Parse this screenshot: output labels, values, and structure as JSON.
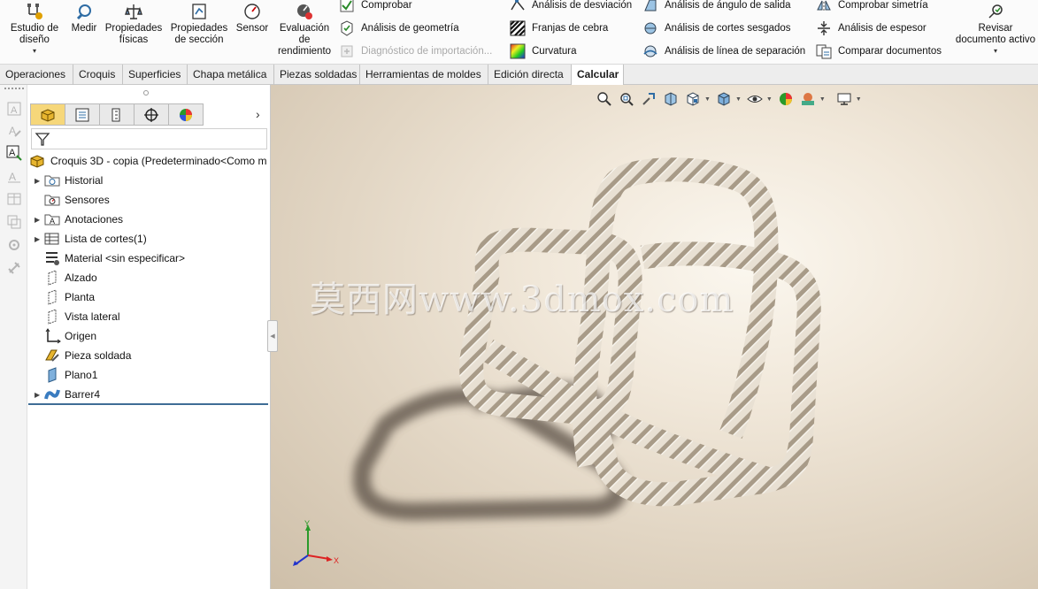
{
  "ribbon": {
    "big_buttons": [
      {
        "id": "estudio",
        "label_line1": "Estudio de",
        "label_line2": "diseño",
        "icon": "design-study-icon",
        "has_dropdown": true
      },
      {
        "id": "medir",
        "label_line1": "Medir",
        "label_line2": "",
        "icon": "measure-icon"
      },
      {
        "id": "propfisicas",
        "label_line1": "Propiedades",
        "label_line2": "físicas",
        "icon": "mass-properties-icon"
      },
      {
        "id": "propseccion",
        "label_line1": "Propiedades",
        "label_line2": "de sección",
        "icon": "section-properties-icon"
      },
      {
        "id": "sensor",
        "label_line1": "Sensor",
        "label_line2": "",
        "icon": "sensor-gauge-icon"
      },
      {
        "id": "evalrend",
        "label_line1": "Evaluación",
        "label_line2": "de",
        "label_line3": "rendimiento",
        "icon": "performance-evaluation-icon"
      },
      {
        "id": "revisar",
        "label_line1": "Revisar",
        "label_line2": "documento activo",
        "icon": "review-document-icon",
        "has_dropdown": true
      }
    ],
    "small_buttons": {
      "comprobar": "Comprobar",
      "analisis_geometria": "Análisis de geometría",
      "diagnostico": "Diagnóstico de importación...",
      "analisis_desviacion": "Análisis de desviación",
      "franjas_cebra": "Franjas de cebra",
      "curvatura": "Curvatura",
      "analisis_angulo_salida": "Análisis de ángulo de salida",
      "analisis_cortes_sesgados": "Análisis de cortes sesgados",
      "analisis_linea_separacion": "Análisis de línea de separación",
      "comprobar_simetria": "Comprobar simetría",
      "analisis_espesor": "Análisis de espesor",
      "comparar_documentos": "Comparar documentos"
    }
  },
  "tabs": [
    {
      "label": "Operaciones"
    },
    {
      "label": "Croquis"
    },
    {
      "label": "Superficies"
    },
    {
      "label": "Chapa metálica"
    },
    {
      "label": "Piezas soldadas"
    },
    {
      "label": "Herramientas de moldes"
    },
    {
      "label": "Edición directa"
    },
    {
      "label": "Calcular",
      "active": true
    }
  ],
  "feature_tree": {
    "root_label": "Croquis 3D - copia  (Predeterminado<Como m",
    "items": [
      {
        "label": "Historial",
        "icon": "history-folder-icon",
        "expandable": true
      },
      {
        "label": "Sensores",
        "icon": "sensors-folder-icon",
        "expandable": false
      },
      {
        "label": "Anotaciones",
        "icon": "annotations-folder-icon",
        "expandable": true
      },
      {
        "label": "Lista de cortes(1)",
        "icon": "cut-list-icon",
        "expandable": true
      },
      {
        "label": "Material <sin especificar>",
        "icon": "material-icon",
        "expandable": false
      },
      {
        "label": "Alzado",
        "icon": "plane-icon",
        "expandable": false
      },
      {
        "label": "Planta",
        "icon": "plane-icon",
        "expandable": false
      },
      {
        "label": "Vista lateral",
        "icon": "plane-icon",
        "expandable": false
      },
      {
        "label": "Origen",
        "icon": "origin-icon",
        "expandable": false
      },
      {
        "label": "Pieza soldada",
        "icon": "weldment-icon",
        "expandable": false
      },
      {
        "label": "Plano1",
        "icon": "plane1-icon",
        "expandable": false
      },
      {
        "label": "Barrer4",
        "icon": "sweep-icon",
        "expandable": true
      }
    ]
  },
  "viewport": {
    "watermark": "莫西网www.3dmox.com",
    "triad_labels": {
      "x": "X",
      "y": "Y"
    }
  },
  "colors": {
    "rope": "#e6ddd0",
    "rope_shadow": "#5a4f45",
    "active_tab_fill": "#f6d77a",
    "tree_underline": "#3f6d96"
  }
}
